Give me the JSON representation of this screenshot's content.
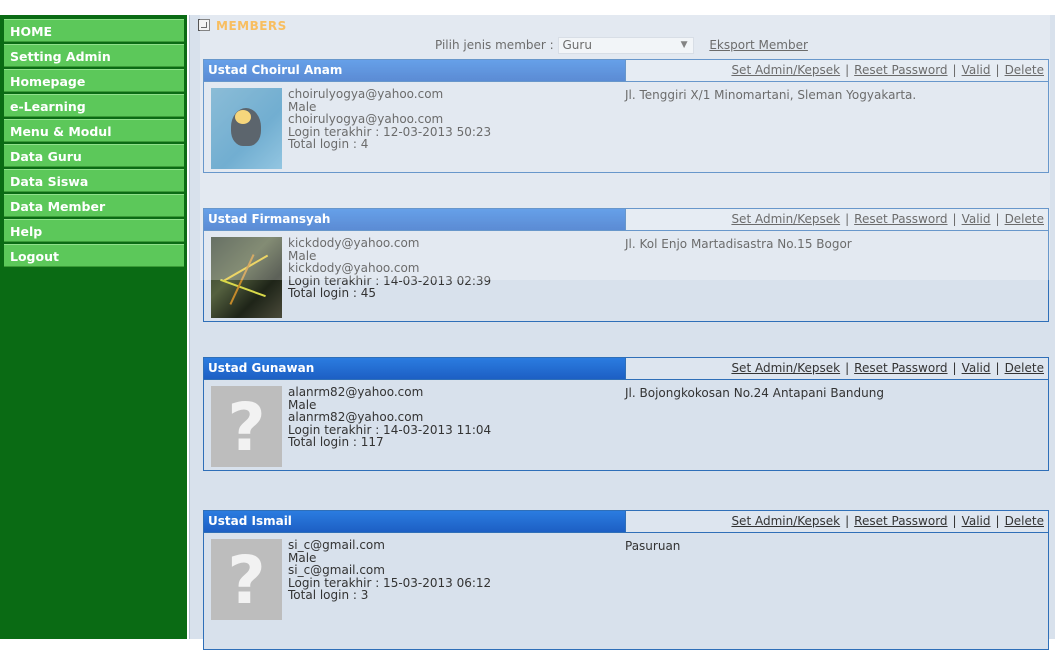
{
  "sidebar": {
    "items": [
      {
        "label": "HOME"
      },
      {
        "label": "Setting Admin"
      },
      {
        "label": "Homepage"
      },
      {
        "label": "e-Learning"
      },
      {
        "label": "Menu & Modul"
      },
      {
        "label": "Data Guru"
      },
      {
        "label": "Data Siswa"
      },
      {
        "label": "Data Member"
      },
      {
        "label": "Help"
      },
      {
        "label": "Logout"
      }
    ]
  },
  "main": {
    "title": "MEMBERS",
    "filter_label": "Pilih jenis member :",
    "filter_value": "Guru",
    "export_label": "Eksport Member"
  },
  "actions": {
    "set_admin": "Set Admin/Kepsek",
    "reset_password": "Reset Password",
    "valid": "Valid",
    "delete": "Delete",
    "separator": "|"
  },
  "members": [
    {
      "name": "Ustad Choirul Anam",
      "email": "choirulyogya@yahoo.com",
      "gender": "Male",
      "email2": "choirulyogya@yahoo.com",
      "last_login": "Login terakhir : 12-03-2013 50:23",
      "total_login": "Total login : 4",
      "address": "Jl. Tenggiri X/1 Minomartani, Sleman Yogyakarta.",
      "avatar": "book-cover-image"
    },
    {
      "name": "Ustad Firmansyah",
      "email": "kickdody@yahoo.com",
      "gender": "Male",
      "email2": "kickdody@yahoo.com",
      "last_login": "Login terakhir : 14-03-2013 02:39",
      "total_login": "Total login : 45",
      "address": "Jl. Kol Enjo Martadisastra No.15 Bogor",
      "avatar": "chalkboard-image"
    },
    {
      "name": "Ustad Gunawan",
      "email": "alanrm82@yahoo.com",
      "gender": "Male",
      "email2": "alanrm82@yahoo.com",
      "last_login": "Login terakhir : 14-03-2013 11:04",
      "total_login": "Total login : 117",
      "address": "Jl. Bojongkokosan No.24 Antapani Bandung",
      "avatar": "question-mark-placeholder"
    },
    {
      "name": "Ustad Ismail",
      "email": "si_c@gmail.com",
      "gender": "Male",
      "email2": "si_c@gmail.com",
      "last_login": "Login terakhir : 15-03-2013 06:12",
      "total_login": "Total login : 3",
      "address": "Pasuruan",
      "avatar": "question-mark-placeholder"
    }
  ],
  "placeholder_glyph": "?"
}
